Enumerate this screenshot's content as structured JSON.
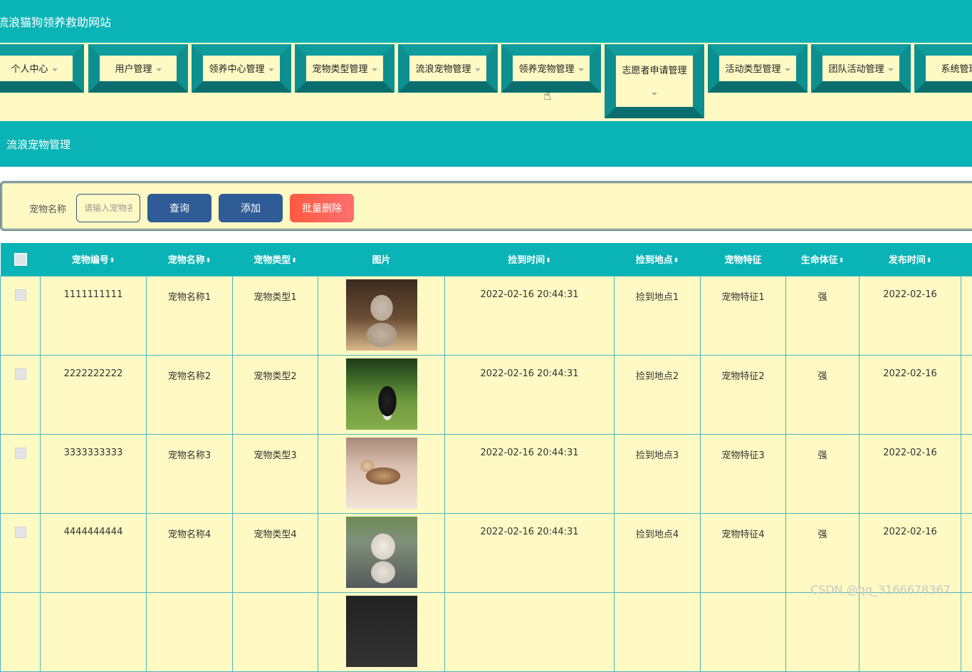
{
  "site": {
    "title": "流浪猫狗领养救助网站"
  },
  "nav": {
    "items": [
      {
        "label": "个人中心"
      },
      {
        "label": "用户管理"
      },
      {
        "label": "领养中心管理"
      },
      {
        "label": "宠物类型管理"
      },
      {
        "label": "流浪宠物管理"
      },
      {
        "label": "领养宠物管理"
      },
      {
        "label": "志愿者申请管理"
      },
      {
        "label": "活动类型管理"
      },
      {
        "label": "团队活动管理"
      },
      {
        "label": "系统管理"
      }
    ]
  },
  "section": {
    "title": "流浪宠物管理"
  },
  "search": {
    "label": "宠物名称",
    "placeholder": "请输入宠物名称",
    "value": "",
    "query_button": "查询",
    "add_button": "添加",
    "batch_delete_button": "批量删除"
  },
  "table": {
    "columns": [
      "宠物编号",
      "宠物名称",
      "宠物类型",
      "图片",
      "捡到时间",
      "捡到地点",
      "宠物特征",
      "生命体征",
      "发布时间"
    ],
    "rows": [
      {
        "id": "1111111111",
        "name": "宠物名称1",
        "type": "宠物类型1",
        "image": "kitten-photo",
        "found_time": "2022-02-16 20:44:31",
        "found_place": "捡到地点1",
        "feature": "宠物特征1",
        "vital": "强",
        "publish_date": "2022-02-16"
      },
      {
        "id": "2222222222",
        "name": "宠物名称2",
        "type": "宠物类型2",
        "image": "border-collie-photo",
        "found_time": "2022-02-16 20:44:31",
        "found_place": "捡到地点2",
        "feature": "宠物特征2",
        "vital": "强",
        "publish_date": "2022-02-16"
      },
      {
        "id": "3333333333",
        "name": "宠物名称3",
        "type": "宠物类型3",
        "image": "lying-cat-photo",
        "found_time": "2022-02-16 20:44:31",
        "found_place": "捡到地点3",
        "feature": "宠物特征3",
        "vital": "强",
        "publish_date": "2022-02-16"
      },
      {
        "id": "4444444444",
        "name": "宠物名称4",
        "type": "宠物类型4",
        "image": "bulldog-photo",
        "found_time": "2022-02-16 20:44:31",
        "found_place": "捡到地点4",
        "feature": "宠物特征4",
        "vital": "强",
        "publish_date": "2022-02-16"
      },
      {
        "id": "",
        "name": "",
        "type": "",
        "image": "dark-photo",
        "found_time": "",
        "found_place": "",
        "feature": "",
        "vital": "",
        "publish_date": ""
      }
    ]
  },
  "watermark": {
    "text": "CSDN @qq_3166678367"
  },
  "colors": {
    "teal": "#0ab3b6",
    "cream": "#fff9c4",
    "navy_button": "#2f5c96",
    "danger_gradient": "#ff5a40"
  }
}
